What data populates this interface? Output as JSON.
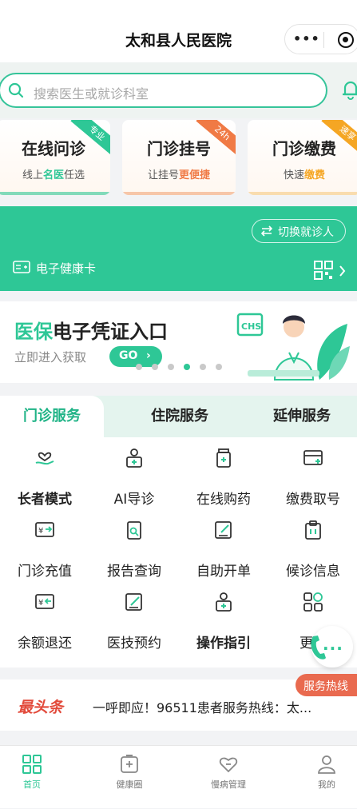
{
  "header": {
    "title": "太和县人民医院",
    "more_label": "•••"
  },
  "search": {
    "placeholder": "搜索医生或就诊科室"
  },
  "quick_cards": [
    {
      "title": "在线问诊",
      "sub_a": "线上",
      "sub_b": "名医",
      "sub_c": "任选",
      "badge": "专业",
      "accent": "#2ec796"
    },
    {
      "title": "门诊挂号",
      "sub_a": "让挂号",
      "sub_b": "更便捷",
      "sub_c": "",
      "badge": "24h",
      "accent": "#f07a45"
    },
    {
      "title": "门诊缴费",
      "sub_a": "快速",
      "sub_b": "缴费",
      "sub_c": "",
      "badge": "速享",
      "accent": "#f5a623"
    }
  ],
  "health_card": {
    "switch_label": "切换就诊人",
    "card_label": "电子健康卡"
  },
  "banner": {
    "title_a": "医保",
    "title_b": "电子凭证入口",
    "subtitle": "立即进入获取",
    "go_label": "GO",
    "illustration_text": "CHS",
    "active_dot": 3,
    "dot_count": 6
  },
  "service_tabs": [
    {
      "label": "门诊服务",
      "active": true
    },
    {
      "label": "住院服务",
      "active": false
    },
    {
      "label": "延伸服务",
      "active": false
    }
  ],
  "services": [
    {
      "label": "长者模式",
      "icon": "elder-care-icon",
      "bold": true
    },
    {
      "label": "AI导诊",
      "icon": "ai-guide-icon",
      "bold": false
    },
    {
      "label": "在线购药",
      "icon": "medicine-icon",
      "bold": false
    },
    {
      "label": "缴费取号",
      "icon": "payment-card-icon",
      "bold": false
    },
    {
      "label": "门诊充值",
      "icon": "recharge-icon",
      "bold": false
    },
    {
      "label": "报告查询",
      "icon": "report-search-icon",
      "bold": false
    },
    {
      "label": "自助开单",
      "icon": "edit-order-icon",
      "bold": false
    },
    {
      "label": "候诊信息",
      "icon": "waiting-info-icon",
      "bold": false
    },
    {
      "label": "余额退还",
      "icon": "refund-icon",
      "bold": false
    },
    {
      "label": "医技预约",
      "icon": "appointment-icon",
      "bold": false
    },
    {
      "label": "操作指引",
      "icon": "guide-icon",
      "bold": true
    },
    {
      "label": "更多",
      "icon": "more-grid-icon",
      "bold": false
    }
  ],
  "hotline": {
    "label": "服务热线"
  },
  "news": {
    "logo": "最头条",
    "text": "一呼即应！96511患者服务热线：太..."
  },
  "tabbar": [
    {
      "label": "首页",
      "icon": "home-grid-icon",
      "active": true
    },
    {
      "label": "健康圈",
      "icon": "health-circle-icon",
      "active": false
    },
    {
      "label": "慢病管理",
      "icon": "chronic-care-icon",
      "active": false
    },
    {
      "label": "我的",
      "icon": "user-icon",
      "active": false
    }
  ]
}
